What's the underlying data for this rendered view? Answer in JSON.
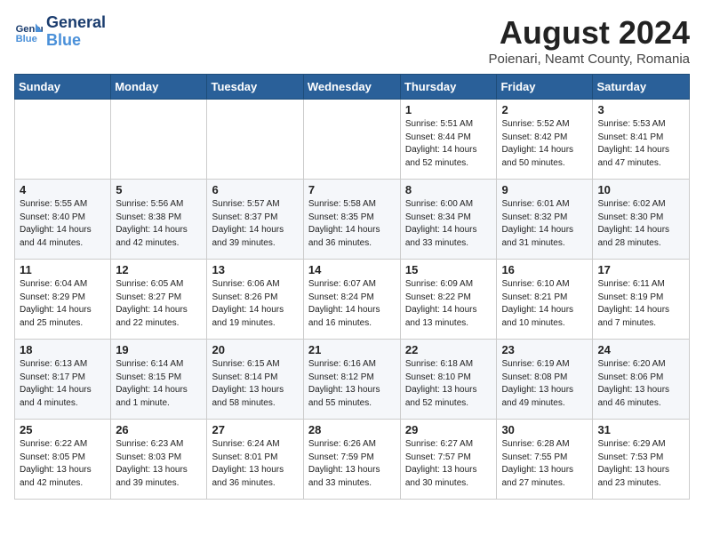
{
  "logo": {
    "line1": "General",
    "line2": "Blue"
  },
  "title": "August 2024",
  "subtitle": "Poienari, Neamt County, Romania",
  "weekdays": [
    "Sunday",
    "Monday",
    "Tuesday",
    "Wednesday",
    "Thursday",
    "Friday",
    "Saturday"
  ],
  "weeks": [
    [
      {
        "day": "",
        "info": ""
      },
      {
        "day": "",
        "info": ""
      },
      {
        "day": "",
        "info": ""
      },
      {
        "day": "",
        "info": ""
      },
      {
        "day": "1",
        "info": "Sunrise: 5:51 AM\nSunset: 8:44 PM\nDaylight: 14 hours\nand 52 minutes."
      },
      {
        "day": "2",
        "info": "Sunrise: 5:52 AM\nSunset: 8:42 PM\nDaylight: 14 hours\nand 50 minutes."
      },
      {
        "day": "3",
        "info": "Sunrise: 5:53 AM\nSunset: 8:41 PM\nDaylight: 14 hours\nand 47 minutes."
      }
    ],
    [
      {
        "day": "4",
        "info": "Sunrise: 5:55 AM\nSunset: 8:40 PM\nDaylight: 14 hours\nand 44 minutes."
      },
      {
        "day": "5",
        "info": "Sunrise: 5:56 AM\nSunset: 8:38 PM\nDaylight: 14 hours\nand 42 minutes."
      },
      {
        "day": "6",
        "info": "Sunrise: 5:57 AM\nSunset: 8:37 PM\nDaylight: 14 hours\nand 39 minutes."
      },
      {
        "day": "7",
        "info": "Sunrise: 5:58 AM\nSunset: 8:35 PM\nDaylight: 14 hours\nand 36 minutes."
      },
      {
        "day": "8",
        "info": "Sunrise: 6:00 AM\nSunset: 8:34 PM\nDaylight: 14 hours\nand 33 minutes."
      },
      {
        "day": "9",
        "info": "Sunrise: 6:01 AM\nSunset: 8:32 PM\nDaylight: 14 hours\nand 31 minutes."
      },
      {
        "day": "10",
        "info": "Sunrise: 6:02 AM\nSunset: 8:30 PM\nDaylight: 14 hours\nand 28 minutes."
      }
    ],
    [
      {
        "day": "11",
        "info": "Sunrise: 6:04 AM\nSunset: 8:29 PM\nDaylight: 14 hours\nand 25 minutes."
      },
      {
        "day": "12",
        "info": "Sunrise: 6:05 AM\nSunset: 8:27 PM\nDaylight: 14 hours\nand 22 minutes."
      },
      {
        "day": "13",
        "info": "Sunrise: 6:06 AM\nSunset: 8:26 PM\nDaylight: 14 hours\nand 19 minutes."
      },
      {
        "day": "14",
        "info": "Sunrise: 6:07 AM\nSunset: 8:24 PM\nDaylight: 14 hours\nand 16 minutes."
      },
      {
        "day": "15",
        "info": "Sunrise: 6:09 AM\nSunset: 8:22 PM\nDaylight: 14 hours\nand 13 minutes."
      },
      {
        "day": "16",
        "info": "Sunrise: 6:10 AM\nSunset: 8:21 PM\nDaylight: 14 hours\nand 10 minutes."
      },
      {
        "day": "17",
        "info": "Sunrise: 6:11 AM\nSunset: 8:19 PM\nDaylight: 14 hours\nand 7 minutes."
      }
    ],
    [
      {
        "day": "18",
        "info": "Sunrise: 6:13 AM\nSunset: 8:17 PM\nDaylight: 14 hours\nand 4 minutes."
      },
      {
        "day": "19",
        "info": "Sunrise: 6:14 AM\nSunset: 8:15 PM\nDaylight: 14 hours\nand 1 minute."
      },
      {
        "day": "20",
        "info": "Sunrise: 6:15 AM\nSunset: 8:14 PM\nDaylight: 13 hours\nand 58 minutes."
      },
      {
        "day": "21",
        "info": "Sunrise: 6:16 AM\nSunset: 8:12 PM\nDaylight: 13 hours\nand 55 minutes."
      },
      {
        "day": "22",
        "info": "Sunrise: 6:18 AM\nSunset: 8:10 PM\nDaylight: 13 hours\nand 52 minutes."
      },
      {
        "day": "23",
        "info": "Sunrise: 6:19 AM\nSunset: 8:08 PM\nDaylight: 13 hours\nand 49 minutes."
      },
      {
        "day": "24",
        "info": "Sunrise: 6:20 AM\nSunset: 8:06 PM\nDaylight: 13 hours\nand 46 minutes."
      }
    ],
    [
      {
        "day": "25",
        "info": "Sunrise: 6:22 AM\nSunset: 8:05 PM\nDaylight: 13 hours\nand 42 minutes."
      },
      {
        "day": "26",
        "info": "Sunrise: 6:23 AM\nSunset: 8:03 PM\nDaylight: 13 hours\nand 39 minutes."
      },
      {
        "day": "27",
        "info": "Sunrise: 6:24 AM\nSunset: 8:01 PM\nDaylight: 13 hours\nand 36 minutes."
      },
      {
        "day": "28",
        "info": "Sunrise: 6:26 AM\nSunset: 7:59 PM\nDaylight: 13 hours\nand 33 minutes."
      },
      {
        "day": "29",
        "info": "Sunrise: 6:27 AM\nSunset: 7:57 PM\nDaylight: 13 hours\nand 30 minutes."
      },
      {
        "day": "30",
        "info": "Sunrise: 6:28 AM\nSunset: 7:55 PM\nDaylight: 13 hours\nand 27 minutes."
      },
      {
        "day": "31",
        "info": "Sunrise: 6:29 AM\nSunset: 7:53 PM\nDaylight: 13 hours\nand 23 minutes."
      }
    ]
  ]
}
